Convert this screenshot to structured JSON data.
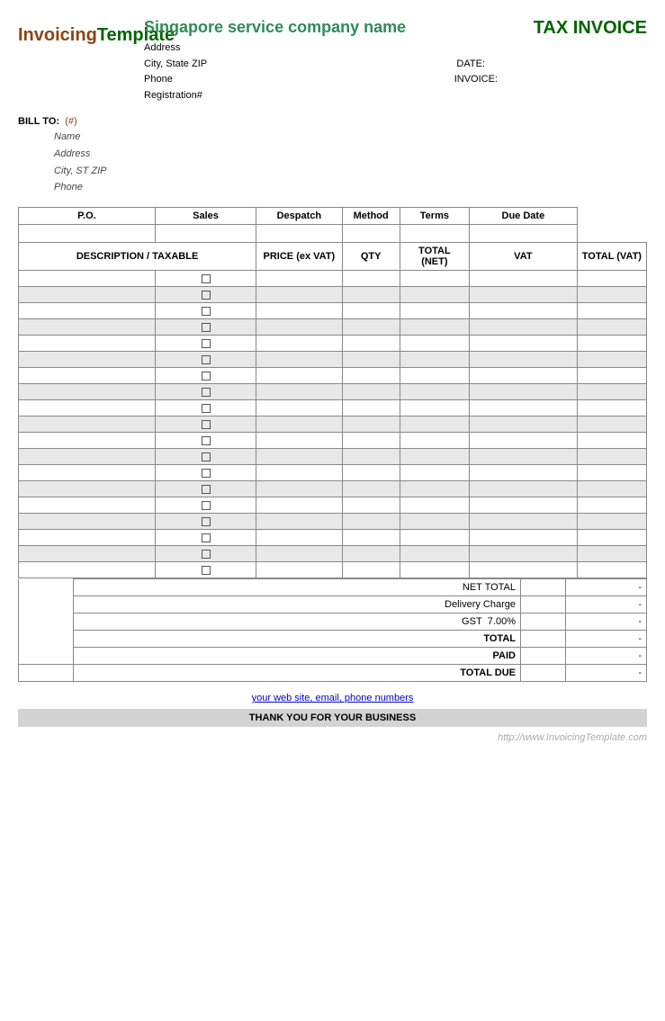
{
  "logo": {
    "invoicing": "Invoicing",
    "template": "Template"
  },
  "company": {
    "name": "Singapore service company name",
    "address": "Address",
    "city_state_zip": "City, State ZIP",
    "phone": "Phone",
    "registration": "Registration#",
    "date_label": "DATE:",
    "invoice_label": "INVOICE:"
  },
  "invoice_title": "TAX INVOICE",
  "bill_to": {
    "label": "BILL TO:",
    "hash": "(#)",
    "name": "Name",
    "address": "Address",
    "city_st_zip": "City, ST ZIP",
    "phone": "Phone"
  },
  "table": {
    "headers_row1": [
      "P.O.",
      "Sales",
      "Despatch",
      "Method",
      "Terms",
      "Due Date"
    ],
    "headers_row2_left": "DESCRIPTION / TAXABLE",
    "headers_row2": [
      "PRICE (ex VAT)",
      "QTY",
      "TOTAL (NET)",
      "VAT",
      "TOTAL (VAT)"
    ]
  },
  "item_rows": 19,
  "summary": {
    "net_total_label": "NET TOTAL",
    "delivery_charge_label": "Delivery Charge",
    "gst_label": "GST",
    "gst_rate": "7.00%",
    "total_label": "TOTAL",
    "paid_label": "PAID",
    "total_due_label": "TOTAL DUE",
    "dash": "-"
  },
  "footer": {
    "link_text": "your web site, email, phone numbers",
    "thank_you": "THANK YOU FOR YOUR BUSINESS"
  },
  "watermark": "http://www.InvoicingTemplate.com"
}
